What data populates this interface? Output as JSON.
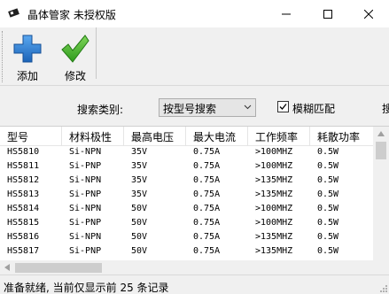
{
  "window": {
    "title": "晶体管家 未授权版",
    "minimize_icon": "minimize-icon",
    "maximize_icon": "maximize-icon",
    "close_icon": "close-icon"
  },
  "toolbar": {
    "add_label": "添加",
    "add_icon": "plus-icon",
    "edit_label": "修改",
    "edit_icon": "checkmark-icon"
  },
  "search": {
    "type_label": "搜索类别:",
    "type_value": "按型号搜索",
    "fuzzy_label": "模糊匹配",
    "fuzzy_checked": true,
    "cut_off_label": "搜"
  },
  "table": {
    "columns": [
      "型号",
      "材料极性",
      "最高电压",
      "最大电流",
      "工作频率",
      "耗散功率"
    ],
    "rows": [
      [
        "HS5810",
        "Si-NPN",
        "35V",
        "0.75A",
        ">100MHZ",
        "0.5W"
      ],
      [
        "HS5811",
        "Si-PNP",
        "35V",
        "0.75A",
        ">100MHZ",
        "0.5W"
      ],
      [
        "HS5812",
        "Si-NPN",
        "35V",
        "0.75A",
        ">135MHZ",
        "0.5W"
      ],
      [
        "HS5813",
        "Si-PNP",
        "35V",
        "0.75A",
        ">135MHZ",
        "0.5W"
      ],
      [
        "HS5814",
        "Si-NPN",
        "50V",
        "0.75A",
        ">100MHZ",
        "0.5W"
      ],
      [
        "HS5815",
        "Si-PNP",
        "50V",
        "0.75A",
        ">100MHZ",
        "0.5W"
      ],
      [
        "HS5816",
        "Si-NPN",
        "50V",
        "0.75A",
        ">135MHZ",
        "0.5W"
      ],
      [
        "HS5817",
        "Si-PNP",
        "50V",
        "0.75A",
        ">135MHZ",
        "0.5W"
      ]
    ]
  },
  "status": {
    "text": "准备就绪, 当前仅显示前 25 条记录"
  },
  "colors": {
    "add_blue": "#2a7fd4",
    "edit_green": "#3fae29"
  }
}
